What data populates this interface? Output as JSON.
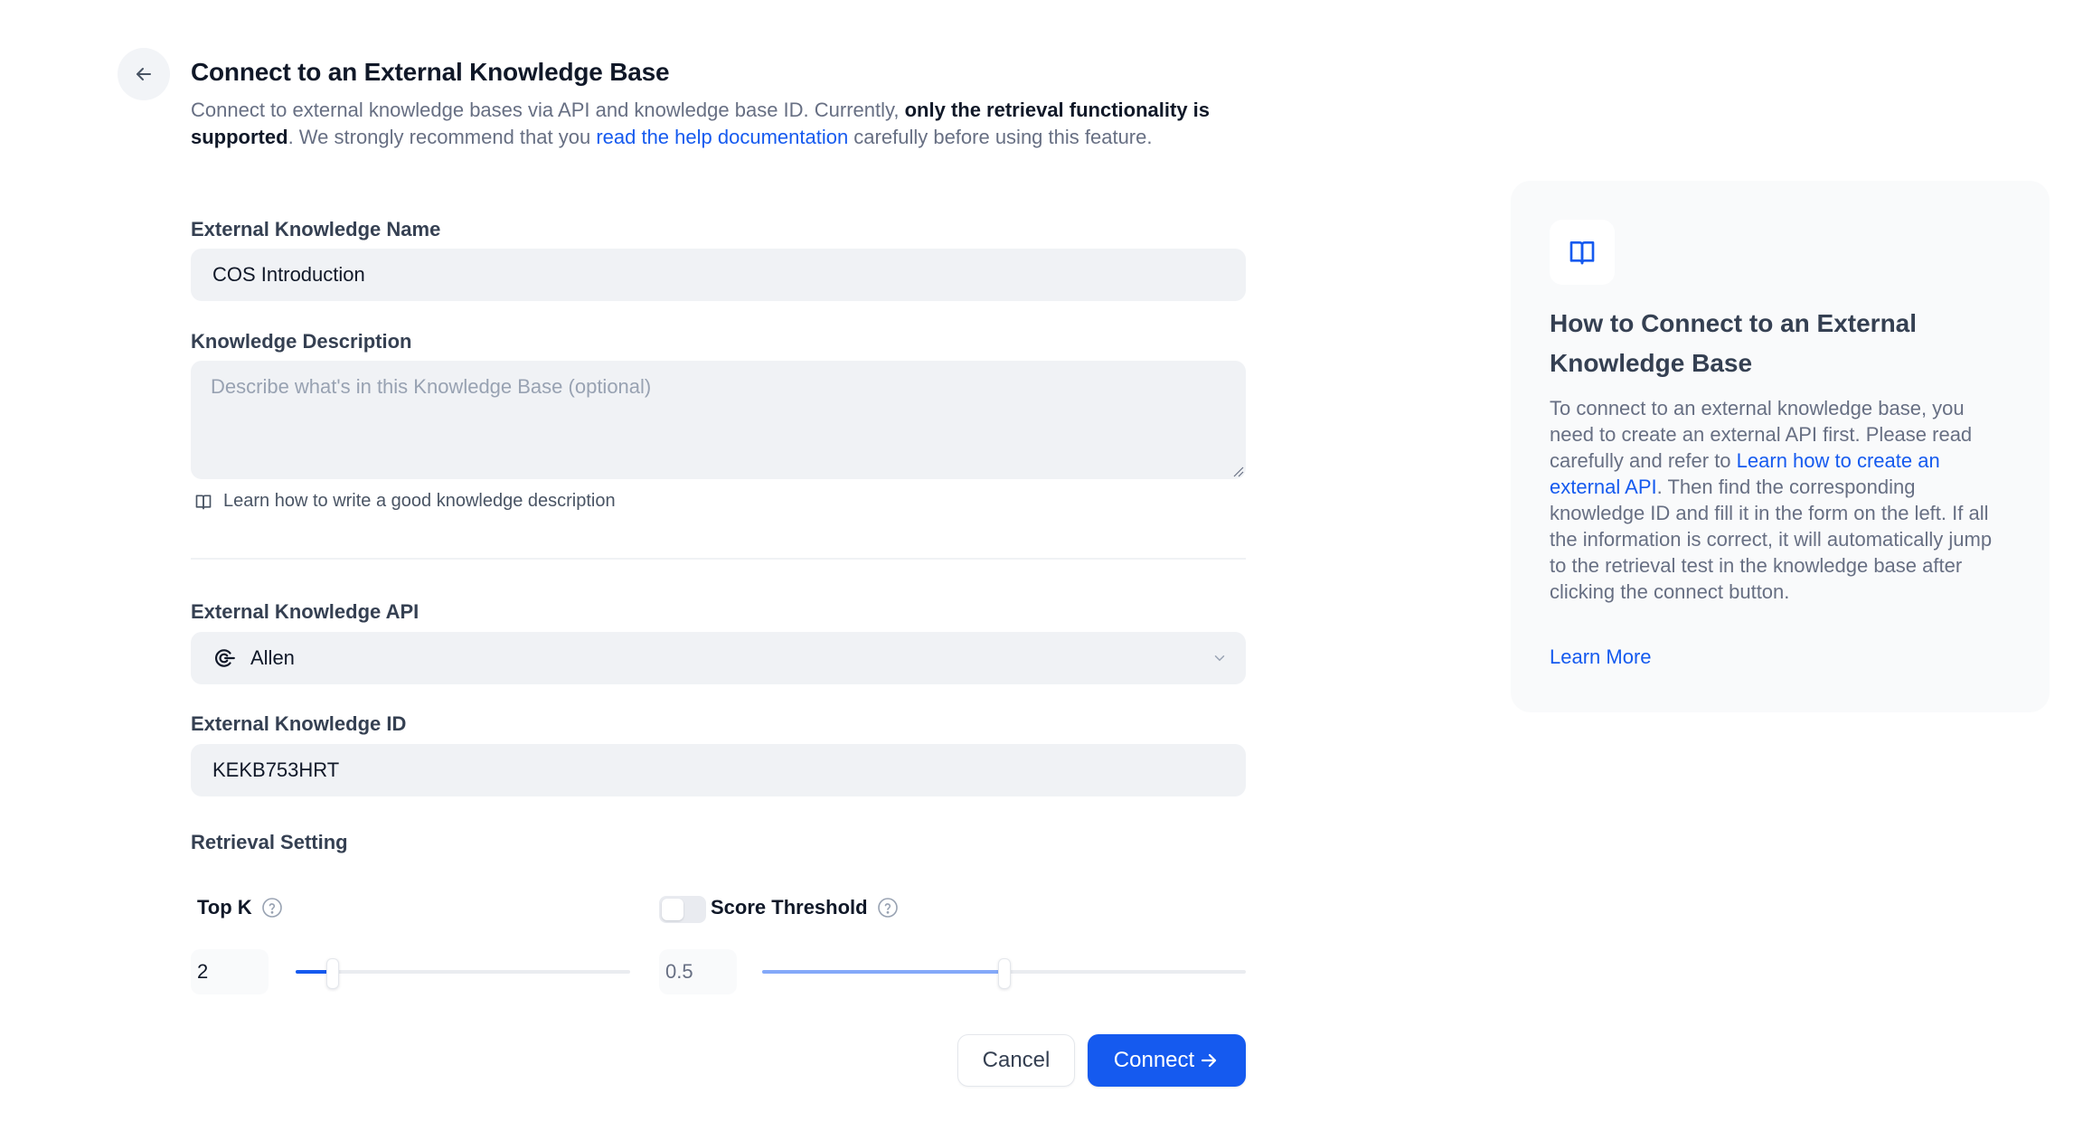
{
  "header": {
    "back_icon": "arrow-left-icon",
    "title": "Connect to an External Knowledge Base",
    "description": {
      "part1": "Connect to external knowledge bases via API and knowledge base ID. Currently, ",
      "bold": "only the retrieval functionality is supported",
      "part2": ". We strongly recommend that you ",
      "link": "read the help documentation",
      "part3": " carefully before using this feature."
    }
  },
  "form": {
    "name": {
      "label": "External Knowledge Name",
      "value": "COS Introduction"
    },
    "description": {
      "label": "Knowledge Description",
      "value": "",
      "placeholder": "Describe what's in this Knowledge Base (optional)",
      "help_icon": "book-open-icon",
      "help_link": "Learn how to write a good knowledge description"
    },
    "api": {
      "label": "External Knowledge API",
      "selected": "Allen",
      "icon": "api-connection-icon"
    },
    "knowledge_id": {
      "label": "External Knowledge ID",
      "value": "KEKB753HRT"
    },
    "retrieval": {
      "label": "Retrieval Setting",
      "top_k": {
        "label": "Top K",
        "value": "2",
        "min": 1,
        "max": 10,
        "fraction": 0.111
      },
      "score_threshold": {
        "label": "Score Threshold",
        "enabled": false,
        "value": "0.5",
        "min": 0,
        "max": 1,
        "fraction": 0.5
      }
    }
  },
  "actions": {
    "cancel": "Cancel",
    "connect": "Connect"
  },
  "panel": {
    "icon": "book-open-icon",
    "title": "How to Connect to an External Knowledge Base",
    "body": {
      "part1": "To connect to an external knowledge base, you need to create an external API first. Please read carefully and refer to ",
      "link": "Learn how to create an external API",
      "part2": ". Then find the corresponding knowledge ID and fill it in the form on the left. If all the information is correct, it will automatically jump to the retrieval test in the knowledge base after clicking the connect button."
    },
    "learn_more": "Learn More"
  },
  "colors": {
    "accent": "#155aef",
    "threshold_fill": "#84a9f9",
    "field_bg": "#f0f2f5"
  }
}
